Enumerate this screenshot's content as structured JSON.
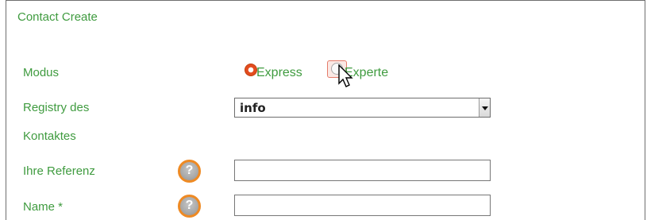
{
  "form": {
    "title": "Contact Create",
    "modus": {
      "label": "Modus",
      "options": [
        "Express",
        "Experte"
      ],
      "selected": "Express"
    },
    "registry": {
      "label_line1": "Registry des",
      "label_line2": "Kontaktes",
      "selected_value": "info"
    },
    "reference": {
      "label": "Ihre Referenz",
      "help_icon": "?",
      "value": ""
    },
    "name": {
      "label": "Name *",
      "help_icon": "?",
      "value": ""
    }
  },
  "colors": {
    "label_green": "#3f9b3f",
    "radio_selected": "#e34c1f",
    "help_border": "#ee8a24"
  }
}
